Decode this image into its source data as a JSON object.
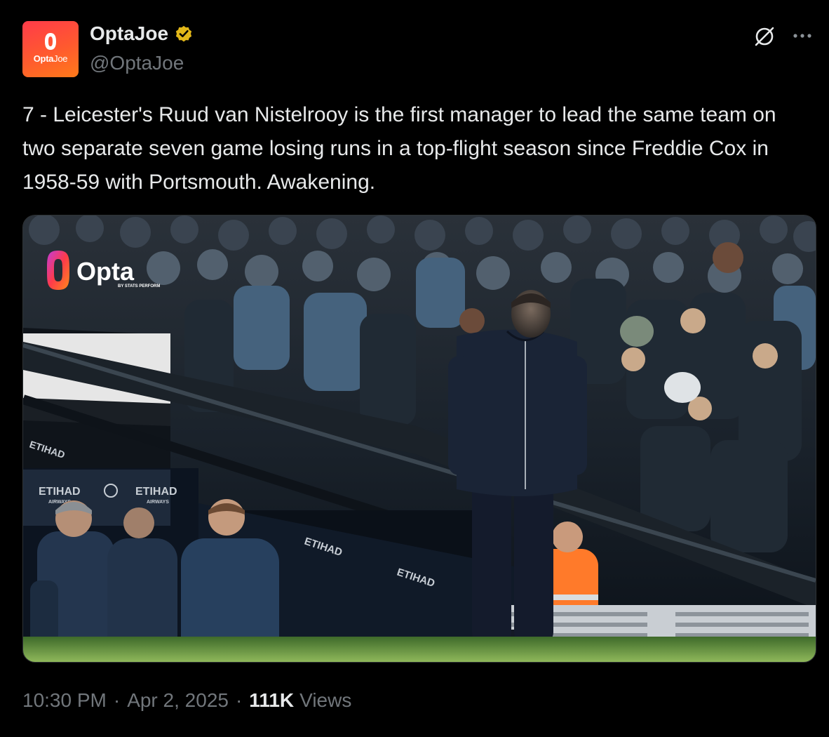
{
  "author": {
    "display_name": "OptaJoe",
    "handle": "@OptaJoe",
    "verified": true,
    "avatar_text_bold": "Opta",
    "avatar_text_light": "Joe"
  },
  "header_actions": {
    "grok_icon": "grok-icon",
    "more_icon": "more-icon"
  },
  "tweet": {
    "text": "7 - Leicester's Ruud van Nistelrooy is the first manager to lead the same team on two separate seven game losing runs in a top-flight season since Freddie Cox in 1958-59 with Portsmouth. Awakening."
  },
  "media": {
    "logo_text": "Opta",
    "logo_subtext": "BY STATS PERFORM",
    "signage": [
      "ETIHAD",
      "ETIHAD",
      "ETIHAD",
      "ETIHAD",
      "ETIHAD"
    ],
    "signage_sub": "AIRWAYS"
  },
  "footer": {
    "time": "10:30 PM",
    "date": "Apr 2, 2025",
    "views_count": "111K",
    "views_label": "Views"
  },
  "colors": {
    "background": "#000000",
    "text_primary": "#e7e9ea",
    "text_secondary": "#71767b",
    "verified_gold": "#e2b719",
    "opta_gradient_start": "#ff3b4a",
    "opta_gradient_end": "#ff7a1a"
  }
}
